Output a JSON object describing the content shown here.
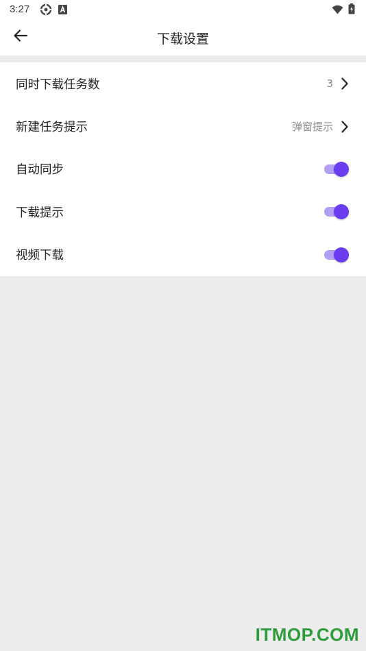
{
  "status_bar": {
    "time": "3:27",
    "icons": [
      "settings-gear-icon",
      "a-badge-icon",
      "wifi-icon",
      "battery-icon"
    ]
  },
  "app_bar": {
    "back_icon": "arrow-left-icon",
    "title": "下载设置"
  },
  "settings": {
    "items": [
      {
        "label": "同时下载任务数",
        "type": "select",
        "value": "3",
        "icon": "chevron-right-icon"
      },
      {
        "label": "新建任务提示",
        "type": "select",
        "value": "弹窗提示",
        "icon": "chevron-right-icon"
      },
      {
        "label": "自动同步",
        "type": "toggle",
        "on": true
      },
      {
        "label": "下载提示",
        "type": "toggle",
        "on": true
      },
      {
        "label": "视频下载",
        "type": "toggle",
        "on": true
      }
    ]
  },
  "colors": {
    "accent": "#6a3df0",
    "accent_track": "#b39ef5",
    "background": "#ededed",
    "watermark": "#2e9b3a"
  },
  "watermark": "ITMOP.COM"
}
